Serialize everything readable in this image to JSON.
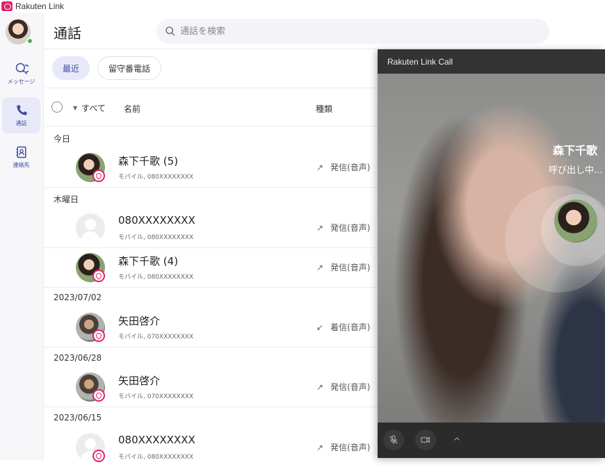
{
  "app": {
    "window_title": "Rakuten Link"
  },
  "sidebar": {
    "items": [
      {
        "label": "メッセージ"
      },
      {
        "label": "通話"
      },
      {
        "label": "連絡先"
      }
    ]
  },
  "header": {
    "title": "通話",
    "search_placeholder": "通話を検索"
  },
  "filters": {
    "recent": "最近",
    "voicemail": "留守番電話"
  },
  "columns": {
    "all": "すべて",
    "name": "名前",
    "type": "種類"
  },
  "sections": [
    {
      "label": "今日"
    },
    {
      "label": "木曜日"
    },
    {
      "label": "2023/07/02"
    },
    {
      "label": "2023/06/28"
    },
    {
      "label": "2023/06/15"
    }
  ],
  "calls": [
    {
      "name": "森下千歌",
      "count": "(5)",
      "sub": "モバイル, 080XXXXXXXX",
      "direction": "発信(音声)",
      "arrow": "↗"
    },
    {
      "name": "080XXXXXXXX",
      "count": "",
      "sub": "モバイル, 080XXXXXXXX",
      "direction": "発信(音声)",
      "arrow": "↗"
    },
    {
      "name": "森下千歌",
      "count": "(4)",
      "sub": "モバイル, 080XXXXXXXX",
      "direction": "発信(音声)",
      "arrow": "↗"
    },
    {
      "name": "矢田啓介",
      "count": "",
      "sub": "モバイル, 070XXXXXXXX",
      "direction": "着信(音声)",
      "arrow": "↙"
    },
    {
      "name": "矢田啓介",
      "count": "",
      "sub": "モバイル, 070XXXXXXXX",
      "direction": "発信(音声)",
      "arrow": "↗"
    },
    {
      "name": "080XXXXXXXX",
      "count": "",
      "sub": "モバイル, 080XXXXXXXX",
      "direction": "発信(音声)",
      "arrow": "↗"
    }
  ],
  "call_window": {
    "title": "Rakuten Link Call",
    "callee": "森下千歌",
    "status": "呼び出し中..."
  },
  "colors": {
    "accent": "#3d4a9e",
    "brand": "#e0236e",
    "active_bg": "#e8e9f8"
  }
}
